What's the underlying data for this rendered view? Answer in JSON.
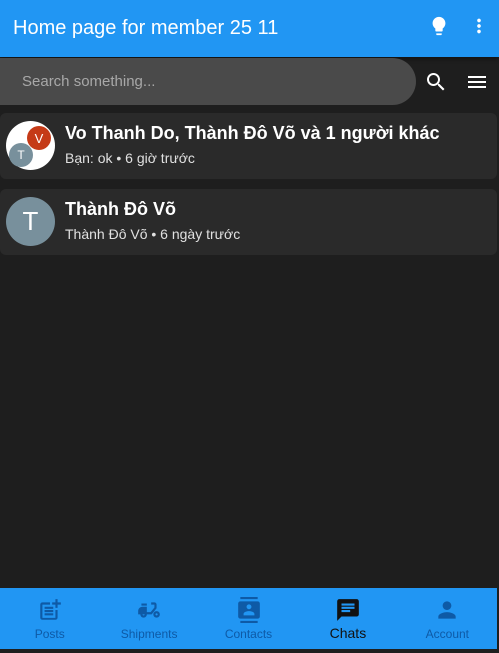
{
  "appbar": {
    "title": "Home page for member 25 11",
    "lightbulb_icon": "lightbulb-icon",
    "more_icon": "more-vert-icon"
  },
  "search": {
    "placeholder": "Search something...",
    "value": "",
    "search_icon": "search-icon",
    "menu_icon": "menu-icon"
  },
  "chats": [
    {
      "title": "Vo Thanh Do, Thành Đô Võ và 1 người khác",
      "subtitle": "Bạn: ok • 6 giờ trước",
      "avatar_letters": [
        "V",
        "T"
      ]
    },
    {
      "title": "Thành Đô Võ",
      "subtitle": "Thành Đô Võ • 6 ngày trước",
      "avatar_letter": "T"
    }
  ],
  "bottom_nav": {
    "items": [
      {
        "label": "Posts",
        "icon": "post-add-icon"
      },
      {
        "label": "Shipments",
        "icon": "scooter-icon"
      },
      {
        "label": "Contacts",
        "icon": "contacts-icon"
      },
      {
        "label": "Chats",
        "icon": "chat-icon",
        "active": true
      },
      {
        "label": "Account",
        "icon": "person-icon"
      }
    ]
  },
  "colors": {
    "primary": "#2196f3",
    "background": "#1e1e1e",
    "card": "#2a2a2a",
    "search_bg": "#4a4a4a",
    "avatar_grey": "#78909c",
    "avatar_red": "#c53a17",
    "nav_inactive": "#0e5aa6"
  }
}
